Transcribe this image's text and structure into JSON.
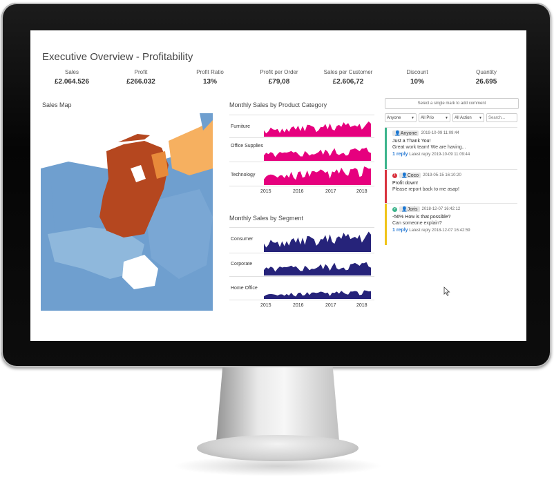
{
  "dashboard": {
    "title": "Executive Overview - Profitability",
    "kpis": [
      {
        "label": "Sales",
        "value": "£2.064.526"
      },
      {
        "label": "Profit",
        "value": "£266.032"
      },
      {
        "label": "Profit Ratio",
        "value": "13%"
      },
      {
        "label": "Profit per Order",
        "value": "£79,08"
      },
      {
        "label": "Sales per Customer",
        "value": "£2.606,72"
      },
      {
        "label": "Discount",
        "value": "10%"
      },
      {
        "label": "Quantity",
        "value": "26.695"
      }
    ],
    "map_title": "Sales Map",
    "map_colors": {
      "high": "#b5471f",
      "mid": "#e88a3a",
      "light_orange": "#f6b060",
      "blue": "#6f9fcf",
      "light_blue": "#8fb8dc"
    }
  },
  "chart_data": [
    {
      "type": "area",
      "title": "Monthly Sales by Product Category",
      "color": "#e6007e",
      "series": [
        {
          "name": "Furniture"
        },
        {
          "name": "Office Supplies"
        },
        {
          "name": "Technology"
        }
      ],
      "x_ticks": [
        "2015",
        "2016",
        "2017",
        "2018"
      ]
    },
    {
      "type": "area",
      "title": "Monthly Sales by Segment",
      "color": "#26237a",
      "series": [
        {
          "name": "Consumer"
        },
        {
          "name": "Corporate"
        },
        {
          "name": "Home Office"
        }
      ],
      "x_ticks": [
        "2015",
        "2016",
        "2017",
        "2018"
      ]
    }
  ],
  "comments": {
    "search_placeholder": "Select a single mark to add comment",
    "filters": [
      "Anyone",
      "All Prio",
      "All Action",
      "Search..."
    ],
    "items": [
      {
        "user": "Anyone",
        "date": "2019-10-09 11:09:44",
        "text1": "Just a Thank You!",
        "text2": "Great work team! We are having...",
        "reply": "1 reply",
        "latest": "Latest reply 2019-10-09 11:09:44",
        "color": "#3cb48c"
      },
      {
        "user": "Coco",
        "date": "2019-05-15 16:10:20",
        "text1": "Profit down!",
        "text2": "Please report back to me asap!",
        "color": "#d9333f"
      },
      {
        "user": "Joris",
        "date": "2018-12-07 16:42:12",
        "text1": "-56% How is that possible?",
        "text2": "Can someone explain?",
        "reply": "1 reply",
        "latest": "Latest reply 2018-12-07 16:42:59",
        "color": "#f0c419"
      }
    ]
  }
}
